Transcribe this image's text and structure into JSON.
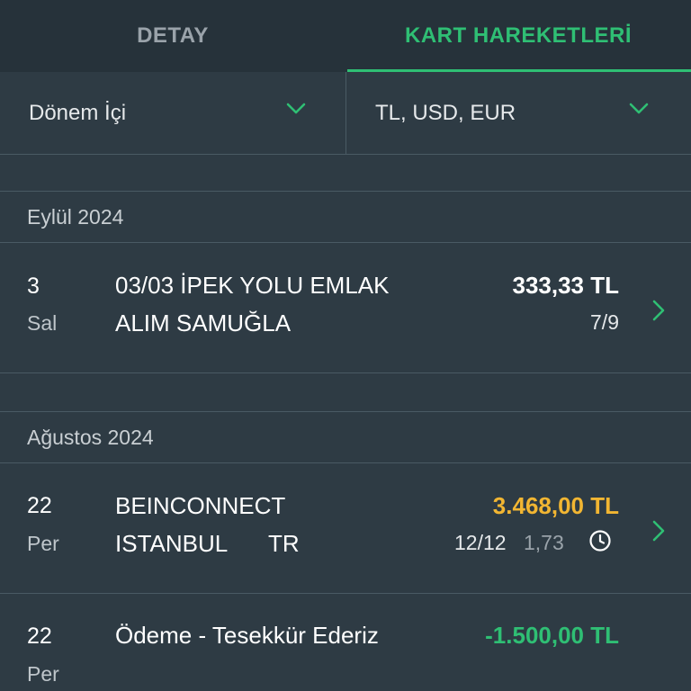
{
  "tabs": [
    {
      "label": "DETAY",
      "active": false
    },
    {
      "label": "KART HAREKETLERİ",
      "active": true
    }
  ],
  "filters": {
    "period": "Dönem İçi",
    "currency": "TL, USD, EUR"
  },
  "colors": {
    "accent": "#2fbf74",
    "pending_amount": "#f2b632",
    "payment_amount": "#2fbf74",
    "background": "#2e3b44"
  },
  "sections": [
    {
      "title": "Eylül 2024",
      "transactions": [
        {
          "day": "3",
          "weekday": "Sal",
          "line1": "03/03 İPEK YOLU EMLAK",
          "line2": "ALIM SAMUĞLA",
          "amount": "333,33 TL",
          "installment": "7/9",
          "icon": "chevron-right-icon"
        }
      ]
    },
    {
      "title": "Ağustos 2024",
      "transactions": [
        {
          "day": "22",
          "weekday": "Per",
          "line1": "BEINCONNECT",
          "line2_a": "ISTANBUL",
          "line2_b": "TR",
          "amount": "3.468,00 TL",
          "installment": "12/12",
          "rate": "1,73",
          "status_icon": "clock-icon",
          "icon": "chevron-right-icon"
        },
        {
          "day": "22",
          "weekday": "Per",
          "line1": "Ödeme - Tesekkür Ederiz",
          "amount": "-1.500,00 TL"
        }
      ]
    }
  ]
}
